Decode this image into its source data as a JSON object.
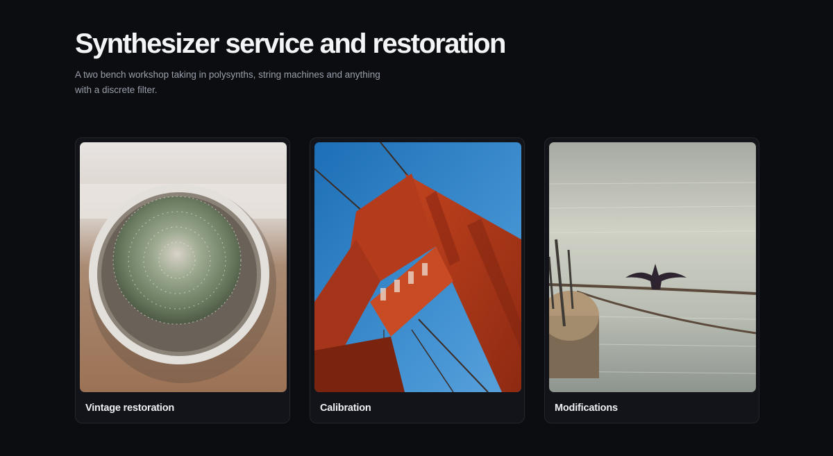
{
  "page": {
    "title": "Synthesizer service and restoration",
    "subtitle": "A two bench workshop taking in polysynths, string machines and anything with a discrete filter."
  },
  "cards": [
    {
      "label": "Vintage restoration"
    },
    {
      "label": "Calibration"
    },
    {
      "label": "Modifications"
    }
  ],
  "colors": {
    "background": "#0b0d11",
    "card_background": "#121419",
    "card_border": "#23262d",
    "title": "#f4f5f7",
    "subtitle": "#9aa0aa"
  }
}
